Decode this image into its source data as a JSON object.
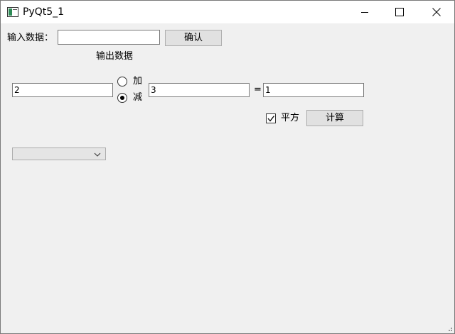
{
  "window": {
    "title": "PyQt5_1",
    "controls": {
      "minimize": "minimize-icon",
      "maximize": "maximize-icon",
      "close": "close-icon"
    }
  },
  "form": {
    "input_label": "输入数据：",
    "input_value": "",
    "confirm_button": "确认",
    "output_label": "输出数据"
  },
  "calc": {
    "operand1": "2",
    "radio_add_label": "加",
    "radio_add_checked": false,
    "radio_sub_label": "减",
    "radio_sub_checked": true,
    "operand2": "3",
    "equals": "=",
    "result": "1",
    "square_label": "平方",
    "square_checked": true,
    "compute_button": "计算"
  },
  "combo": {
    "selected": ""
  }
}
